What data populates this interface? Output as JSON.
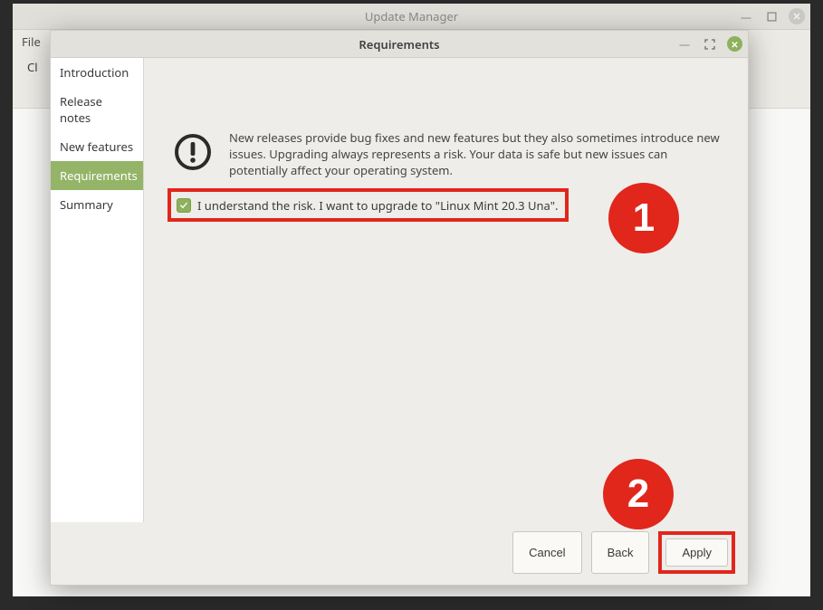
{
  "main_window": {
    "title": "Update Manager",
    "menu": {
      "file": "File",
      "more": "Cl"
    },
    "controls": {
      "minimize": "—",
      "maximize": "◻",
      "close": "✕"
    }
  },
  "modal": {
    "title": "Requirements",
    "controls": {
      "minimize": "—",
      "maximize": "⤢",
      "close": "✕"
    },
    "sidebar": {
      "items": [
        {
          "label": "Introduction"
        },
        {
          "label": "Release notes"
        },
        {
          "label": "New features"
        },
        {
          "label": "Requirements",
          "active": true
        },
        {
          "label": "Summary"
        }
      ]
    },
    "content": {
      "warning_text": "New releases provide bug fixes and new features but they also sometimes introduce new issues. Upgrading always represents a risk. Your data is safe but new issues can potentially affect your operating system.",
      "consent_text": "I understand the risk. I want to upgrade to \"Linux Mint 20.3 Una\".",
      "checkbox_checked": "✓"
    },
    "footer": {
      "cancel": "Cancel",
      "back": "Back",
      "apply": "Apply"
    }
  },
  "annotations": {
    "badge1": "1",
    "badge2": "2"
  }
}
